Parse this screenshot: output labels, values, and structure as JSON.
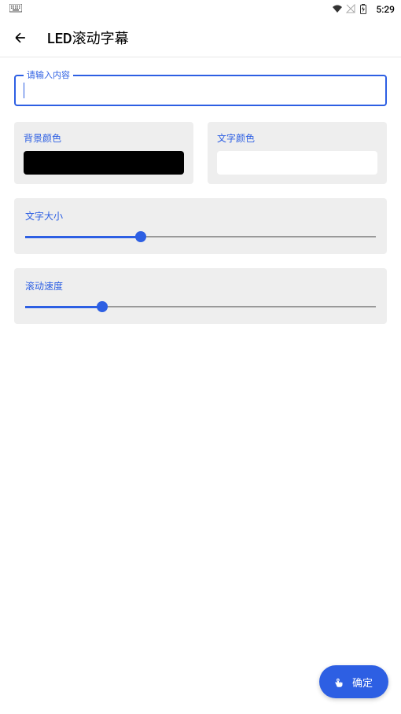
{
  "statusBar": {
    "time": "5:29"
  },
  "appBar": {
    "title": "LED滚动字幕"
  },
  "input": {
    "label": "请输入内容",
    "value": ""
  },
  "backgroundColor": {
    "label": "背景颜色",
    "value": "#000000"
  },
  "textColor": {
    "label": "文字颜色",
    "value": "#ffffff"
  },
  "fontSize": {
    "label": "文字大小",
    "percent": 33
  },
  "scrollSpeed": {
    "label": "滚动速度",
    "percent": 22
  },
  "fab": {
    "label": "确定"
  }
}
